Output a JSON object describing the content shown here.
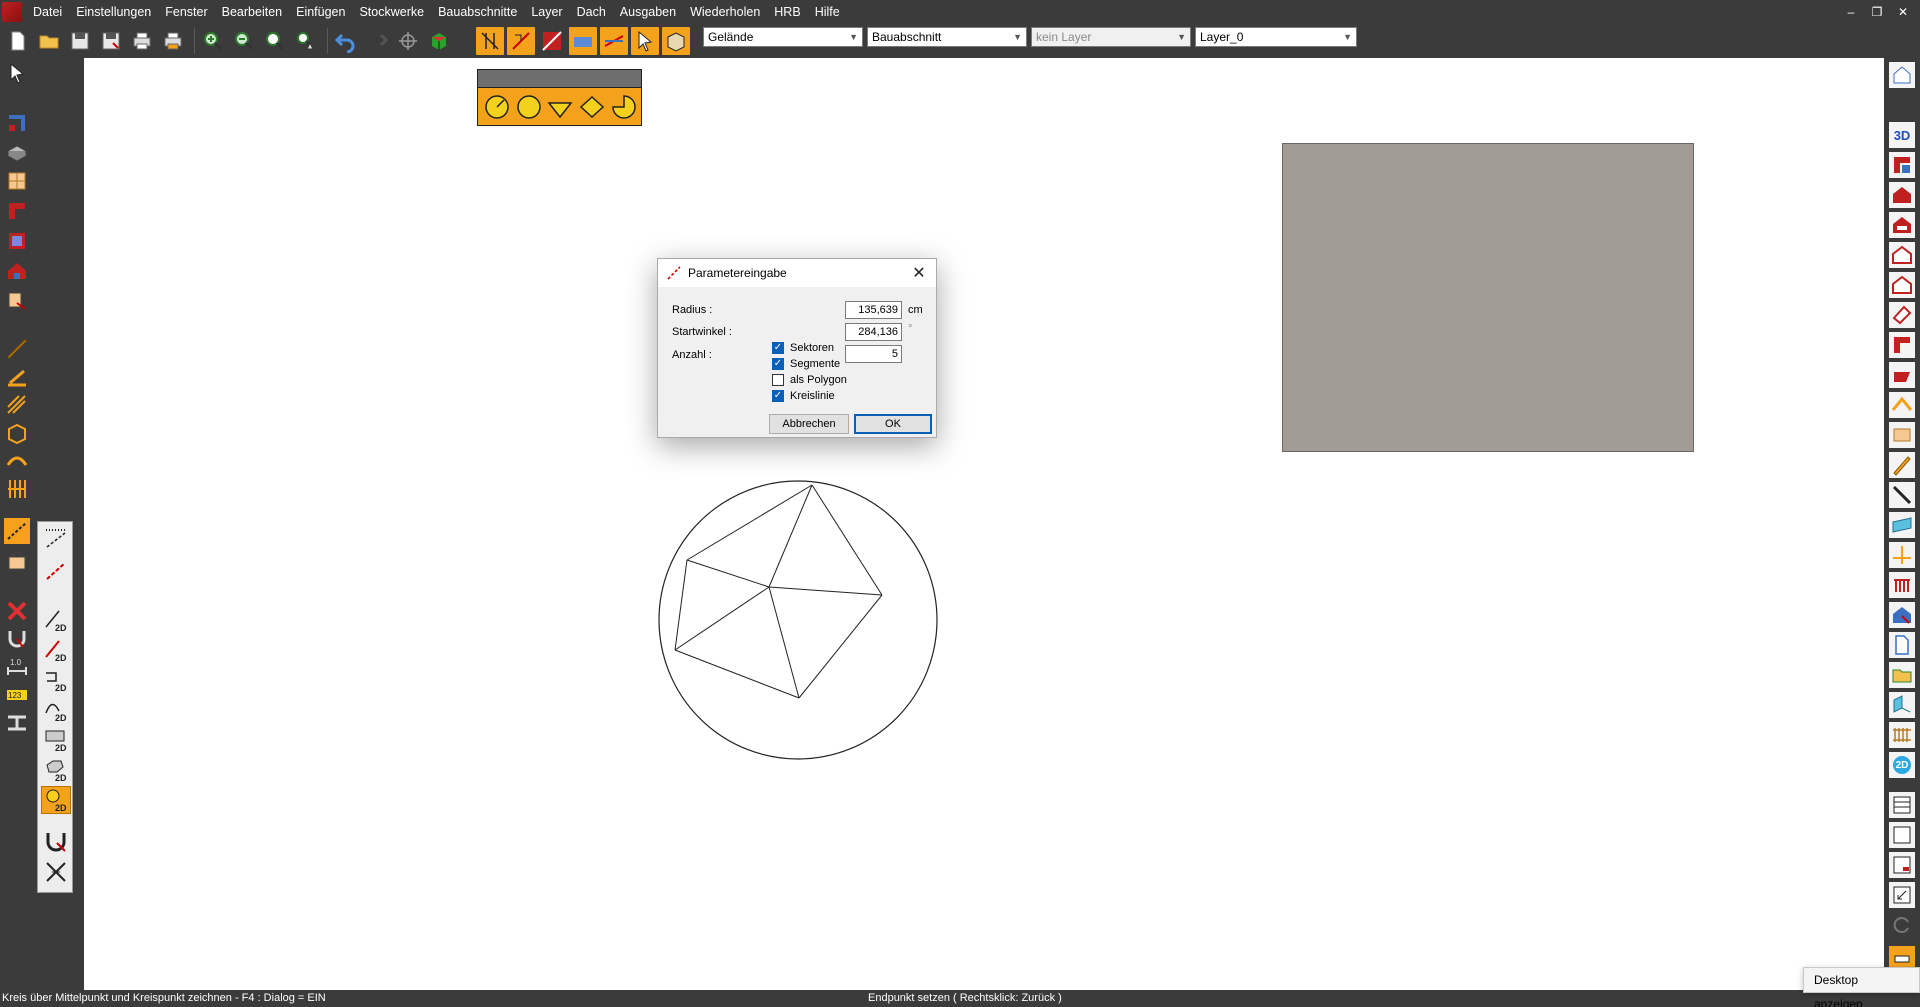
{
  "menu": {
    "items": [
      "Datei",
      "Einstellungen",
      "Fenster",
      "Bearbeiten",
      "Einfügen",
      "Stockwerke",
      "Bauabschnitte",
      "Layer",
      "Dach",
      "Ausgaben",
      "Wiederholen",
      "HRB",
      "Hilfe"
    ],
    "window_controls": [
      "–",
      "❐",
      "✕"
    ]
  },
  "combos": {
    "gelaende": "Gelände",
    "bauabschnitt": "Bauabschnitt",
    "layer_none": "kein Layer",
    "layer": "Layer_0"
  },
  "dialog": {
    "title": "Parametereingabe",
    "radius_label": "Radius :",
    "radius_value": "135,639",
    "radius_unit": "cm",
    "startwinkel_label": "Startwinkel :",
    "startwinkel_value": "284,136",
    "startwinkel_unit": "°",
    "anzahl_label": "Anzahl :",
    "anzahl_value": "5",
    "checkboxes": [
      {
        "label": "Sektoren",
        "checked": true
      },
      {
        "label": "Segmente",
        "checked": true
      },
      {
        "label": "als Polygon",
        "checked": false
      },
      {
        "label": "Kreislinie",
        "checked": true
      }
    ],
    "cancel_label": "Abbrechen",
    "ok_label": "OK"
  },
  "subpanel": {
    "labels_2d": [
      "2D",
      "2D",
      "2D",
      "2D",
      "2D",
      "2D",
      "2D"
    ]
  },
  "rightbar": {
    "label_3d": "3D",
    "label_2d": "2D"
  },
  "statusbar": {
    "left": "Kreis über Mittelpunkt und Kreispunkt zeichnen - F4 : Dialog = EIN",
    "center": "Endpunkt setzen ( Rechtsklick: Zurück )"
  },
  "tooltip": {
    "desktop": "Desktop anzeigen"
  },
  "colors": {
    "chrome": "#3b3b3b",
    "accent_orange": "#f4a11c",
    "gray_rect": "#a29c96",
    "checkbox_blue": "#0a5fb6"
  }
}
